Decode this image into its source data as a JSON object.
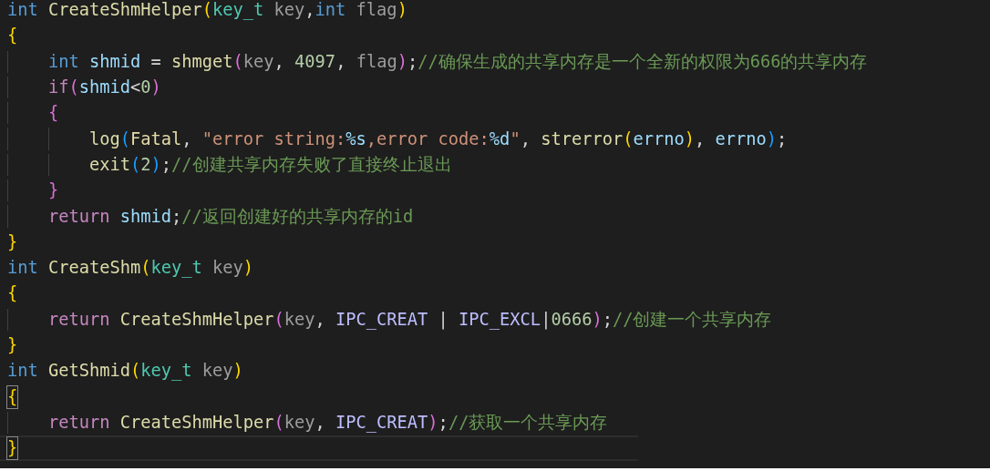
{
  "editor": {
    "lines": [
      {
        "current": false,
        "matched": false,
        "tokens": [
          {
            "keyword": "int "
          },
          {
            "function": "CreateShmHelper"
          },
          {
            "bracket1": "("
          },
          {
            "type": "key_t "
          },
          {
            "param": "key"
          },
          {
            "punct": ","
          },
          {
            "keyword": "int "
          },
          {
            "param": "flag"
          },
          {
            "bracket1": ")"
          }
        ]
      },
      {
        "current": false,
        "matched": false,
        "tokens": [
          {
            "bracket1": "{"
          }
        ]
      },
      {
        "current": false,
        "matched": false,
        "tokens": [
          {
            "keyword": "    int "
          },
          {
            "variable": "shmid"
          },
          {
            "punct": " = "
          },
          {
            "function": "shmget"
          },
          {
            "bracket2": "("
          },
          {
            "param": "key"
          },
          {
            "punct": ", "
          },
          {
            "number": "4097"
          },
          {
            "punct": ", "
          },
          {
            "param": "flag"
          },
          {
            "bracket2": ")"
          },
          {
            "punct": ";"
          },
          {
            "comment": "//确保生成的共享内存是一个全新的权限为666的共享内存"
          }
        ]
      },
      {
        "current": false,
        "matched": false,
        "tokens": [
          {
            "control": "    if"
          },
          {
            "bracket2": "("
          },
          {
            "variable": "shmid"
          },
          {
            "punct": "<"
          },
          {
            "number": "0"
          },
          {
            "bracket2": ")"
          }
        ]
      },
      {
        "current": false,
        "matched": false,
        "tokens": [
          {
            "bracket2": "    {"
          }
        ]
      },
      {
        "current": false,
        "matched": false,
        "tokens": [
          {
            "function": "        log"
          },
          {
            "bracket3": "("
          },
          {
            "enum": "Fatal"
          },
          {
            "punct": ", "
          },
          {
            "string": "\"error string:"
          },
          {
            "escape": "%s"
          },
          {
            "string": ",error code:"
          },
          {
            "escape": "%d"
          },
          {
            "string": "\""
          },
          {
            "punct": ", "
          },
          {
            "function": "strerror"
          },
          {
            "bracket1": "("
          },
          {
            "variable": "errno"
          },
          {
            "bracket1": ")"
          },
          {
            "punct": ", "
          },
          {
            "variable": "errno"
          },
          {
            "bracket3": ")"
          },
          {
            "punct": ";"
          }
        ]
      },
      {
        "current": false,
        "matched": false,
        "tokens": [
          {
            "function": "        exit"
          },
          {
            "bracket3": "("
          },
          {
            "number": "2"
          },
          {
            "bracket3": ")"
          },
          {
            "punct": ";"
          },
          {
            "comment": "//创建共享内存失败了直接终止退出"
          }
        ]
      },
      {
        "current": false,
        "matched": false,
        "tokens": [
          {
            "bracket2": "    }"
          }
        ]
      },
      {
        "current": false,
        "matched": false,
        "tokens": [
          {
            "control": "    return "
          },
          {
            "variable": "shmid"
          },
          {
            "punct": ";"
          },
          {
            "comment": "//返回创建好的共享内存的id"
          }
        ]
      },
      {
        "current": false,
        "matched": false,
        "tokens": [
          {
            "bracket1": "}"
          }
        ]
      },
      {
        "current": false,
        "matched": false,
        "tokens": [
          {
            "keyword": "int "
          },
          {
            "function": "CreateShm"
          },
          {
            "bracket1": "("
          },
          {
            "type": "key_t "
          },
          {
            "param": "key"
          },
          {
            "bracket1": ")"
          }
        ]
      },
      {
        "current": false,
        "matched": false,
        "tokens": [
          {
            "bracket1": "{"
          }
        ]
      },
      {
        "current": false,
        "matched": false,
        "tokens": [
          {
            "control": "    return "
          },
          {
            "function": "CreateShmHelper"
          },
          {
            "bracket2": "("
          },
          {
            "param": "key"
          },
          {
            "punct": ", "
          },
          {
            "macro": "IPC_CREAT"
          },
          {
            "punct": " | "
          },
          {
            "macro": "IPC_EXCL"
          },
          {
            "punct": "|"
          },
          {
            "number": "0666"
          },
          {
            "bracket2": ")"
          },
          {
            "punct": ";"
          },
          {
            "comment": "//创建一个共享内存"
          }
        ]
      },
      {
        "current": false,
        "matched": false,
        "tokens": [
          {
            "bracket1": "}"
          }
        ]
      },
      {
        "current": false,
        "matched": false,
        "tokens": [
          {
            "keyword": "int "
          },
          {
            "function": "GetShmid"
          },
          {
            "bracket1": "("
          },
          {
            "type": "key_t "
          },
          {
            "param": "key"
          },
          {
            "bracket1": ")"
          }
        ]
      },
      {
        "current": false,
        "matched": true,
        "tokens": [
          {
            "bracket1": "{"
          }
        ]
      },
      {
        "current": false,
        "matched": false,
        "tokens": [
          {
            "control": "    return "
          },
          {
            "function": "CreateShmHelper"
          },
          {
            "bracket2": "("
          },
          {
            "param": "key"
          },
          {
            "punct": ", "
          },
          {
            "macro": "IPC_CREAT"
          },
          {
            "bracket2": ")"
          },
          {
            "punct": ";"
          },
          {
            "comment": "//获取一个共享内存"
          }
        ]
      },
      {
        "current": true,
        "matched": true,
        "tokens": [
          {
            "bracket1": "}"
          }
        ]
      }
    ]
  }
}
